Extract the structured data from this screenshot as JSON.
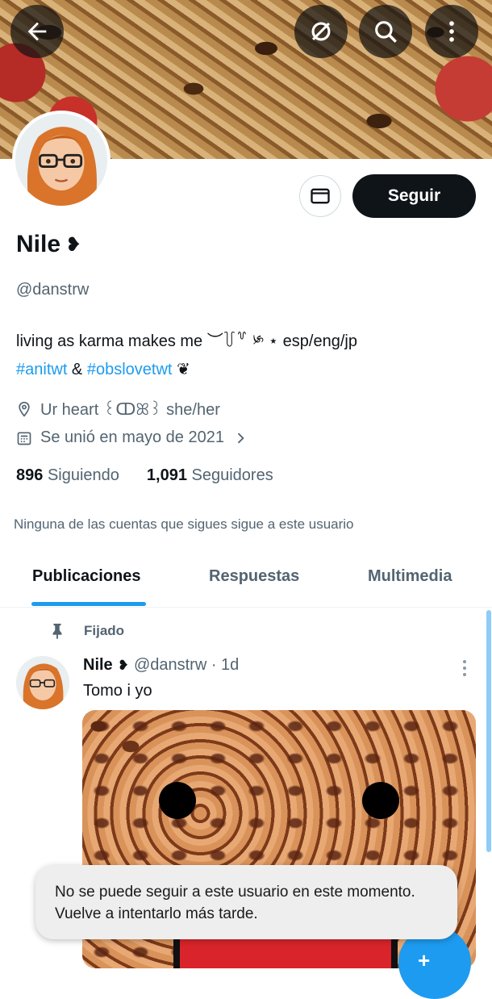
{
  "header": {
    "back_icon": "arrow-left-icon",
    "grok_icon": "slash-circle-icon",
    "search_icon": "search-icon",
    "more_icon": "more-vertical-icon"
  },
  "profile": {
    "follow_label": "Seguir",
    "message_icon": "mail-icon",
    "name": "Nile",
    "name_emoji": "❥",
    "handle": "@danstrw",
    "bio": "living as karma makes me ︶꒦꒷ ༯ ⋆  esp/eng/jp",
    "tag1": "#anitwt",
    "tag_amp": " & ",
    "tag2": "#obslovetwt",
    "tag_emoji": " ❦",
    "location": "Ur heart ꒰ↀꕤ꒱ she/her",
    "joined": "Se unió en mayo de 2021",
    "following_count": "896",
    "following_label": "Siguiendo",
    "followers_count": "1,091",
    "followers_label": "Seguidores",
    "mutuals_note": "Ninguna de las cuentas que sigues sigue a este usuario"
  },
  "tabs": [
    {
      "label": "Publicaciones",
      "active": true
    },
    {
      "label": "Respuestas",
      "active": false
    },
    {
      "label": "Multimedia",
      "active": false
    }
  ],
  "tweet": {
    "pinned_label": "Fijado",
    "author": "Nile",
    "author_emoji": "❥",
    "handle_time": "@danstrw · 1d",
    "text": "Tomo i yo"
  },
  "toast": {
    "line1": "No se puede seguir a este usuario en este momento.",
    "line2": "Vuelve a intentarlo más tarde."
  },
  "colors": {
    "accent": "#1d9bf0",
    "text_primary": "#0f1419",
    "text_secondary": "#536471"
  }
}
